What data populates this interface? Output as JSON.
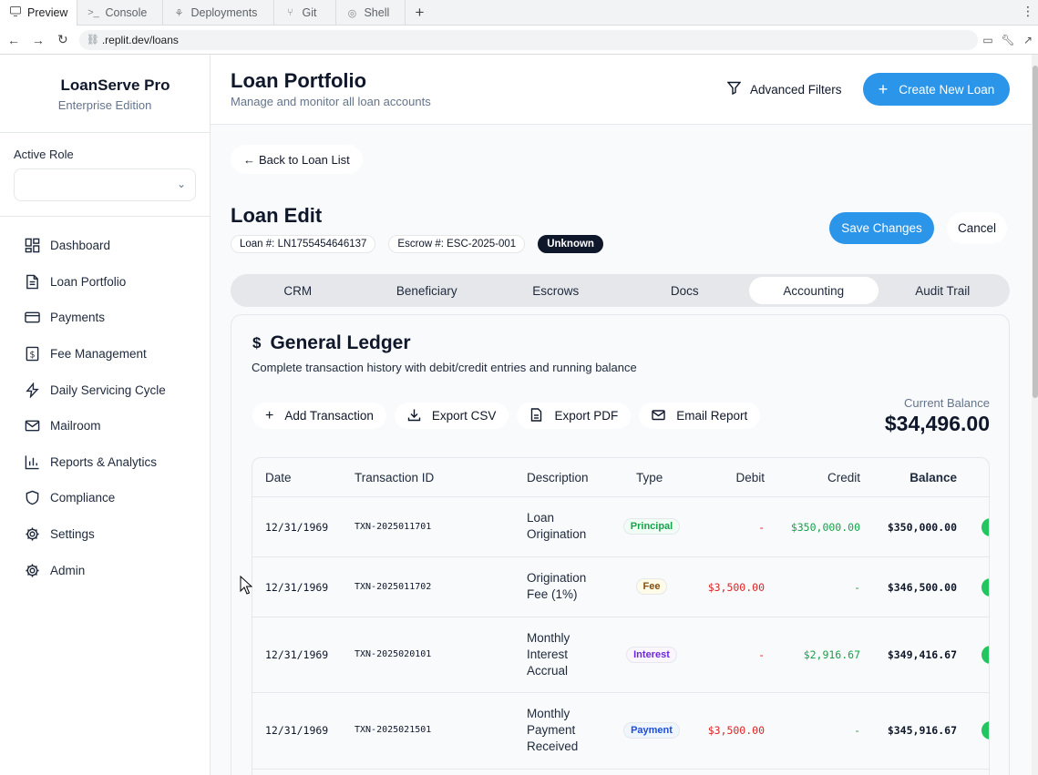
{
  "browser": {
    "tabs": [
      {
        "label": "Preview",
        "icon": "monitor-icon"
      },
      {
        "label": "Console",
        "icon": "terminal-icon"
      },
      {
        "label": "Deployments",
        "icon": "deploy-icon"
      },
      {
        "label": "Git",
        "icon": "git-icon"
      },
      {
        "label": "Shell",
        "icon": "shell-icon"
      }
    ],
    "url": ".replit.dev/loans"
  },
  "sidebar": {
    "brand_title": "LoanServe Pro",
    "brand_subtitle": "Enterprise Edition",
    "role_label": "Active Role",
    "role_value": "",
    "items": [
      {
        "label": "Dashboard",
        "icon": "dashboard-icon"
      },
      {
        "label": "Loan Portfolio",
        "icon": "document-icon"
      },
      {
        "label": "Payments",
        "icon": "credit-card-icon"
      },
      {
        "label": "Fee Management",
        "icon": "dollar-file-icon"
      },
      {
        "label": "Daily Servicing Cycle",
        "icon": "lightning-icon"
      },
      {
        "label": "Mailroom",
        "icon": "mail-icon"
      },
      {
        "label": "Reports & Analytics",
        "icon": "bar-chart-icon"
      },
      {
        "label": "Compliance",
        "icon": "shield-icon"
      },
      {
        "label": "Settings",
        "icon": "gear-icon"
      },
      {
        "label": "Admin",
        "icon": "gear-icon"
      }
    ]
  },
  "header": {
    "title": "Loan Portfolio",
    "subtitle": "Manage and monitor all loan accounts",
    "advanced_filters": "Advanced Filters",
    "create_new": "Create New Loan"
  },
  "edit": {
    "back_label": "Back to Loan List",
    "title": "Loan Edit",
    "loan_chip": "Loan #: LN1755454646137",
    "escrow_chip": "Escrow #: ESC-2025-001",
    "status_chip": "Unknown",
    "save_label": "Save Changes",
    "cancel_label": "Cancel",
    "tabs": [
      "CRM",
      "Beneficiary",
      "Escrows",
      "Docs",
      "Accounting",
      "Audit Trail"
    ],
    "active_tab": "Accounting"
  },
  "ledger": {
    "title": "General Ledger",
    "subtitle": "Complete transaction history with debit/credit entries and running balance",
    "actions": [
      "Add Transaction",
      "Export CSV",
      "Export PDF",
      "Email Report"
    ],
    "balance_label": "Current Balance",
    "balance_value": "$34,496.00",
    "columns": [
      "Date",
      "Transaction ID",
      "Description",
      "Type",
      "Debit",
      "Credit",
      "Balance"
    ],
    "rows": [
      {
        "date": "12/31/1969",
        "id": "TXN-2025011701",
        "description": "Loan Origination",
        "type": "Principal",
        "debit": "-",
        "credit": "$350,000.00",
        "balance": "$350,000.00"
      },
      {
        "date": "12/31/1969",
        "id": "TXN-2025011702",
        "description": "Origination Fee (1%)",
        "type": "Fee",
        "debit": "$3,500.00",
        "credit": "-",
        "balance": "$346,500.00"
      },
      {
        "date": "12/31/1969",
        "id": "TXN-2025020101",
        "description": "Monthly Interest Accrual",
        "type": "Interest",
        "debit": "-",
        "credit": "$2,916.67",
        "balance": "$349,416.67"
      },
      {
        "date": "12/31/1969",
        "id": "TXN-2025021501",
        "description": "Monthly Payment Received",
        "type": "Payment",
        "debit": "$3,500.00",
        "credit": "-",
        "balance": "$345,916.67"
      }
    ]
  },
  "colors": {
    "accent": "#2b95e9",
    "debit": "#dc2626",
    "credit": "#16a34a",
    "principal_badge": "#16a34a",
    "fee_badge": "#ca8a04",
    "interest_badge": "#7c3aed",
    "payment_badge": "#2563eb"
  }
}
